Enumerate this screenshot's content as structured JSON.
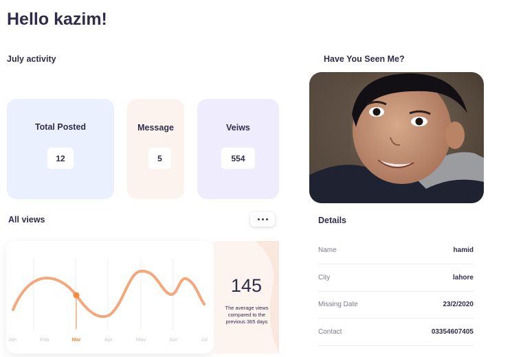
{
  "header": {
    "greeting": "Hello kazim!"
  },
  "activity": {
    "title": "July activity",
    "cards": [
      {
        "label": "Total Posted",
        "value": "12",
        "bg": "#eaf0fe"
      },
      {
        "label": "Message",
        "value": "5",
        "bg": "#fdf3ee"
      },
      {
        "label": "Veiws",
        "value": "554",
        "bg": "#efedfd"
      }
    ]
  },
  "missing": {
    "title": "Have You Seen Me?"
  },
  "views": {
    "title": "All views",
    "months": [
      "Jan",
      "Feb",
      "Mar",
      "Apr",
      "May",
      "Jun",
      "Jul"
    ],
    "active_month": "Mar",
    "stat_number": "145",
    "stat_caption": "The average views compared to the previous 365 days",
    "accent": "#f28a3f"
  },
  "details": {
    "title": "Details",
    "rows": [
      {
        "label": "Name",
        "value": "hamid"
      },
      {
        "label": "City",
        "value": "lahore"
      },
      {
        "label": "Missing Date",
        "value": "23/2/2020"
      },
      {
        "label": "Contact",
        "value": "03354607405"
      }
    ]
  }
}
